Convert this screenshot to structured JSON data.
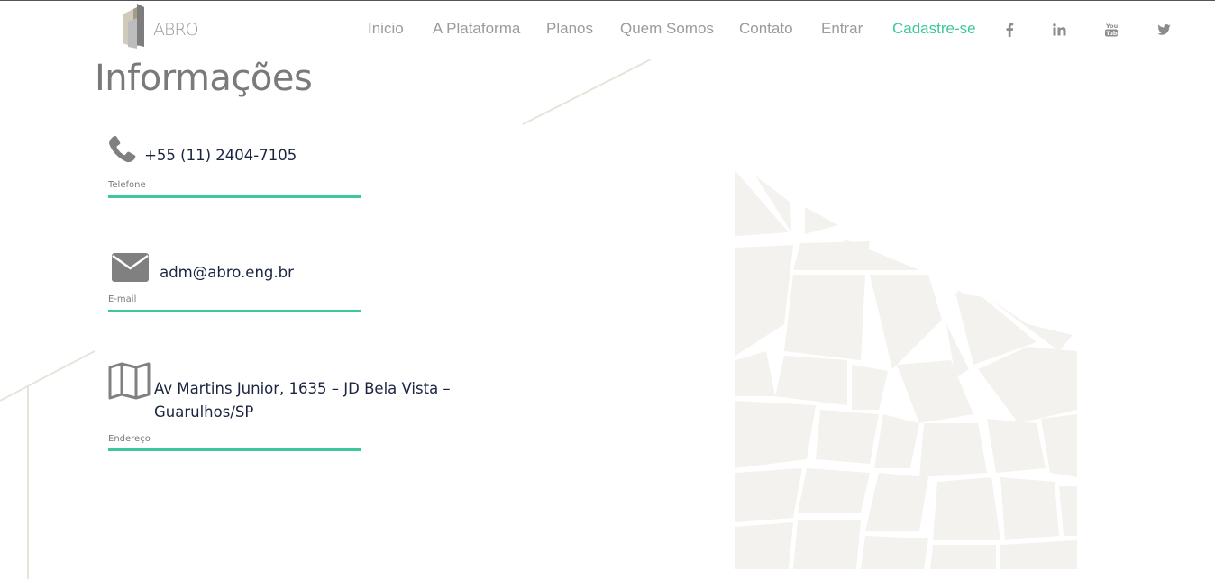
{
  "brand": {
    "logo_text": "ABRO"
  },
  "nav": {
    "items": [
      {
        "label": "Inicio"
      },
      {
        "label": "A Plataforma"
      },
      {
        "label": "Planos"
      },
      {
        "label": "Quem Somos"
      },
      {
        "label": "Contato"
      },
      {
        "label": "Entrar"
      },
      {
        "label": "Cadastre-se"
      }
    ],
    "social": [
      "facebook-icon",
      "linkedin-icon",
      "youtube-icon",
      "twitter-icon"
    ]
  },
  "page": {
    "title": "Informações"
  },
  "info": {
    "phone": {
      "value": "+55 (11) 2404-7105",
      "label": "Telefone",
      "icon": "phone-icon"
    },
    "email": {
      "value": "adm@abro.eng.br",
      "label": "E-mail",
      "icon": "envelope-icon"
    },
    "address": {
      "value": "Av Martins Junior, 1635 – JD Bela Vista – Guarulhos/SP",
      "label": "Endereço",
      "icon": "map-icon"
    }
  },
  "colors": {
    "accent": "#3ec79e",
    "nav_text": "#9b9b9b",
    "value_text": "#1c2540",
    "map_fill": "#f3f2ee"
  }
}
